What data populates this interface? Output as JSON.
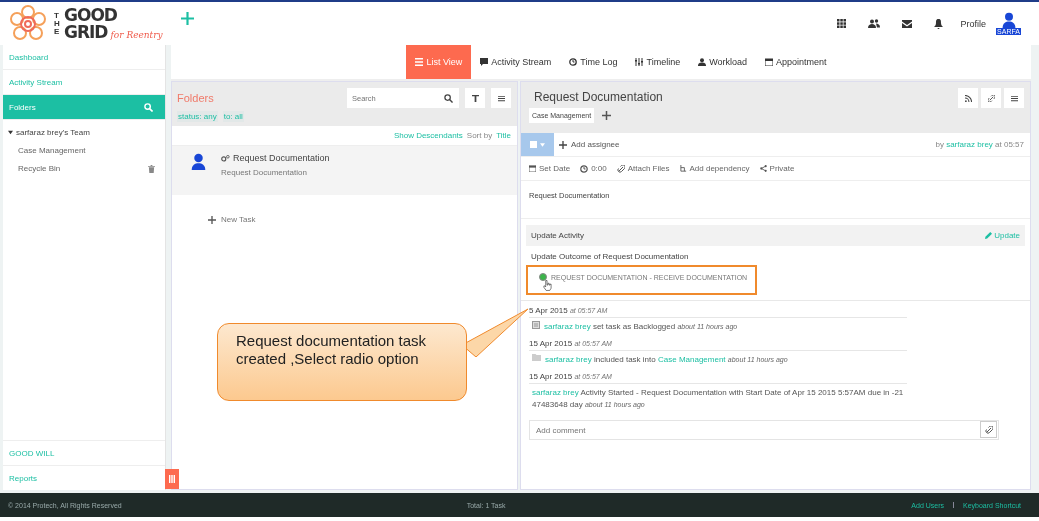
{
  "logo": {
    "the": "THE",
    "good": "GOOD",
    "grid": "GRID",
    "tagline": "for Reentry"
  },
  "header": {
    "profile": "Profile",
    "avatar_badge": "SARFA"
  },
  "sidebar": {
    "items": [
      {
        "label": "Dashboard",
        "selected": false
      },
      {
        "label": "Activity Stream",
        "selected": false
      },
      {
        "label": "Folders",
        "selected": true
      }
    ],
    "tree": [
      {
        "label": "sarfaraz brey's Team",
        "expanded": true,
        "children": [
          {
            "label": "Case Management",
            "kind": "folder"
          },
          {
            "label": "Recycle Bin",
            "kind": "trash"
          }
        ]
      }
    ],
    "bottom_items": [
      "GOOD WILL",
      "Reports"
    ]
  },
  "view_tabs": [
    {
      "label": "List View",
      "selected": true
    },
    {
      "label": "Activity Stream",
      "selected": false
    },
    {
      "label": "Time Log",
      "selected": false
    },
    {
      "label": "Timeline",
      "selected": false
    },
    {
      "label": "Workload",
      "selected": false
    },
    {
      "label": "Appointment",
      "selected": false
    }
  ],
  "folders": {
    "title": "Folders",
    "search_placeholder": "Search",
    "filters": [
      "status: any",
      "to: all"
    ],
    "show_descendants": "Show Descendants",
    "sort_label": "Sort by",
    "sort_value": "Title",
    "tasks": [
      {
        "title": "Request Documentation",
        "subtitle": "Request Documentation"
      }
    ],
    "new_task": "New Task"
  },
  "detail": {
    "title": "Request Documentation",
    "tag": "Case Management",
    "add_assignee": "Add assignee",
    "by": "by",
    "author": "sarfaraz brey",
    "time": "at 05:57",
    "actions": [
      "Set Date",
      "0:00",
      "Attach Files",
      "Add dependency",
      "Private"
    ],
    "description": "Request Documentation",
    "update_title": "Update Activity",
    "update_link": "Update",
    "outcome_label": "Update Outcome of Request Documentation",
    "options": [
      {
        "label": "REQUEST DOCUMENTATION - RECEIVE DOCUMENTATION",
        "selected": true
      }
    ],
    "activity": [
      {
        "date": "5 Apr 2015",
        "time": "at 05:57 AM",
        "parts": [
          {
            "text": "sarfaraz brey",
            "kind": "link"
          },
          {
            "text": "set task as Backlogged",
            "kind": "plain"
          },
          {
            "text": "about 11 hours ago",
            "kind": "muted"
          }
        ]
      },
      {
        "date": "15 Apr 2015",
        "time": "at 05:57 AM",
        "parts": [
          {
            "text": "sarfaraz brey",
            "kind": "link"
          },
          {
            "text": "included task into",
            "kind": "plain"
          },
          {
            "text": "Case Management",
            "kind": "link"
          },
          {
            "text": "about 11 hours ago",
            "kind": "muted"
          }
        ]
      },
      {
        "date": "15 Apr 2015",
        "time": "at 05:57 AM",
        "parts": [
          {
            "text": "sarfaraz brey",
            "kind": "link"
          },
          {
            "text": "Activity Started - Request Documentation with Start Date of Apr 15 2015 5:57AM due in -2147483648 day",
            "kind": "plain"
          },
          {
            "text": "about 11 hours ago",
            "kind": "muted"
          }
        ]
      }
    ],
    "comment_placeholder": "Add comment"
  },
  "callout": "Request documentation task created ,Select radio option",
  "footer": {
    "copyright": "© 2014 Protech, All Rights Reserved",
    "total": "Total: 1 Task",
    "links": [
      "Add Users",
      "Keyboard Shortcut"
    ]
  }
}
